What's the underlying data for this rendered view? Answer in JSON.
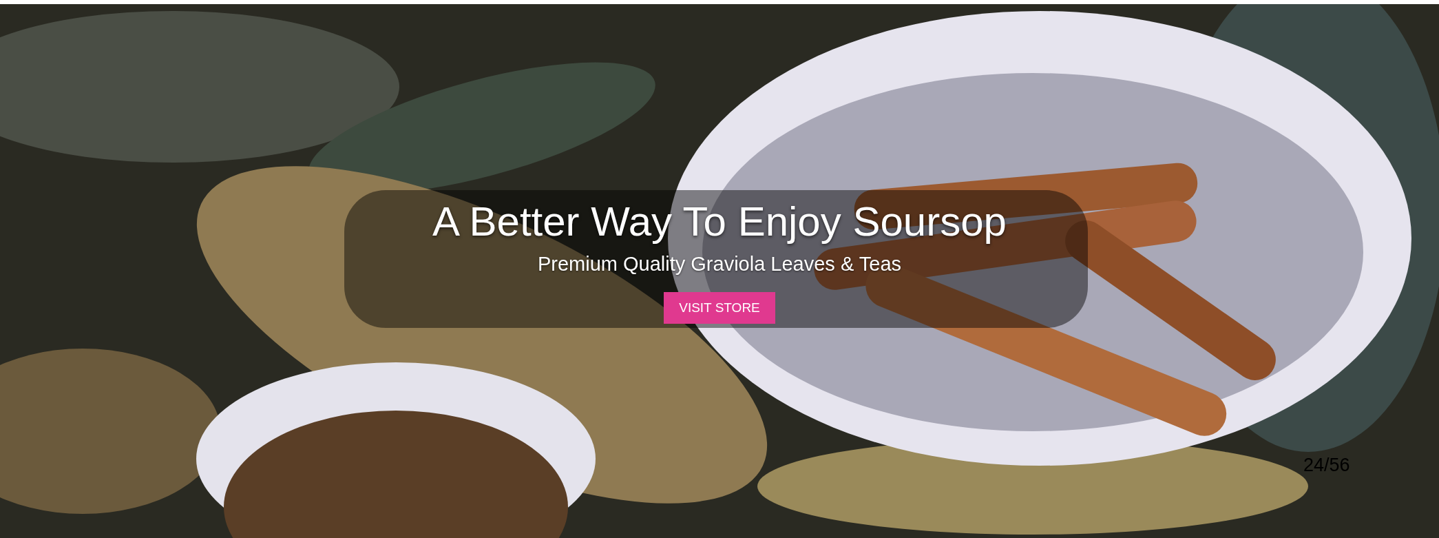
{
  "hero": {
    "kind": "picture",
    "title": "A Better Way To Enjoy Soursop",
    "subtitle": "Premium Quality Graviola Leaves & Teas",
    "button": "VISIT STORE"
  },
  "slide_counter": "24/56"
}
